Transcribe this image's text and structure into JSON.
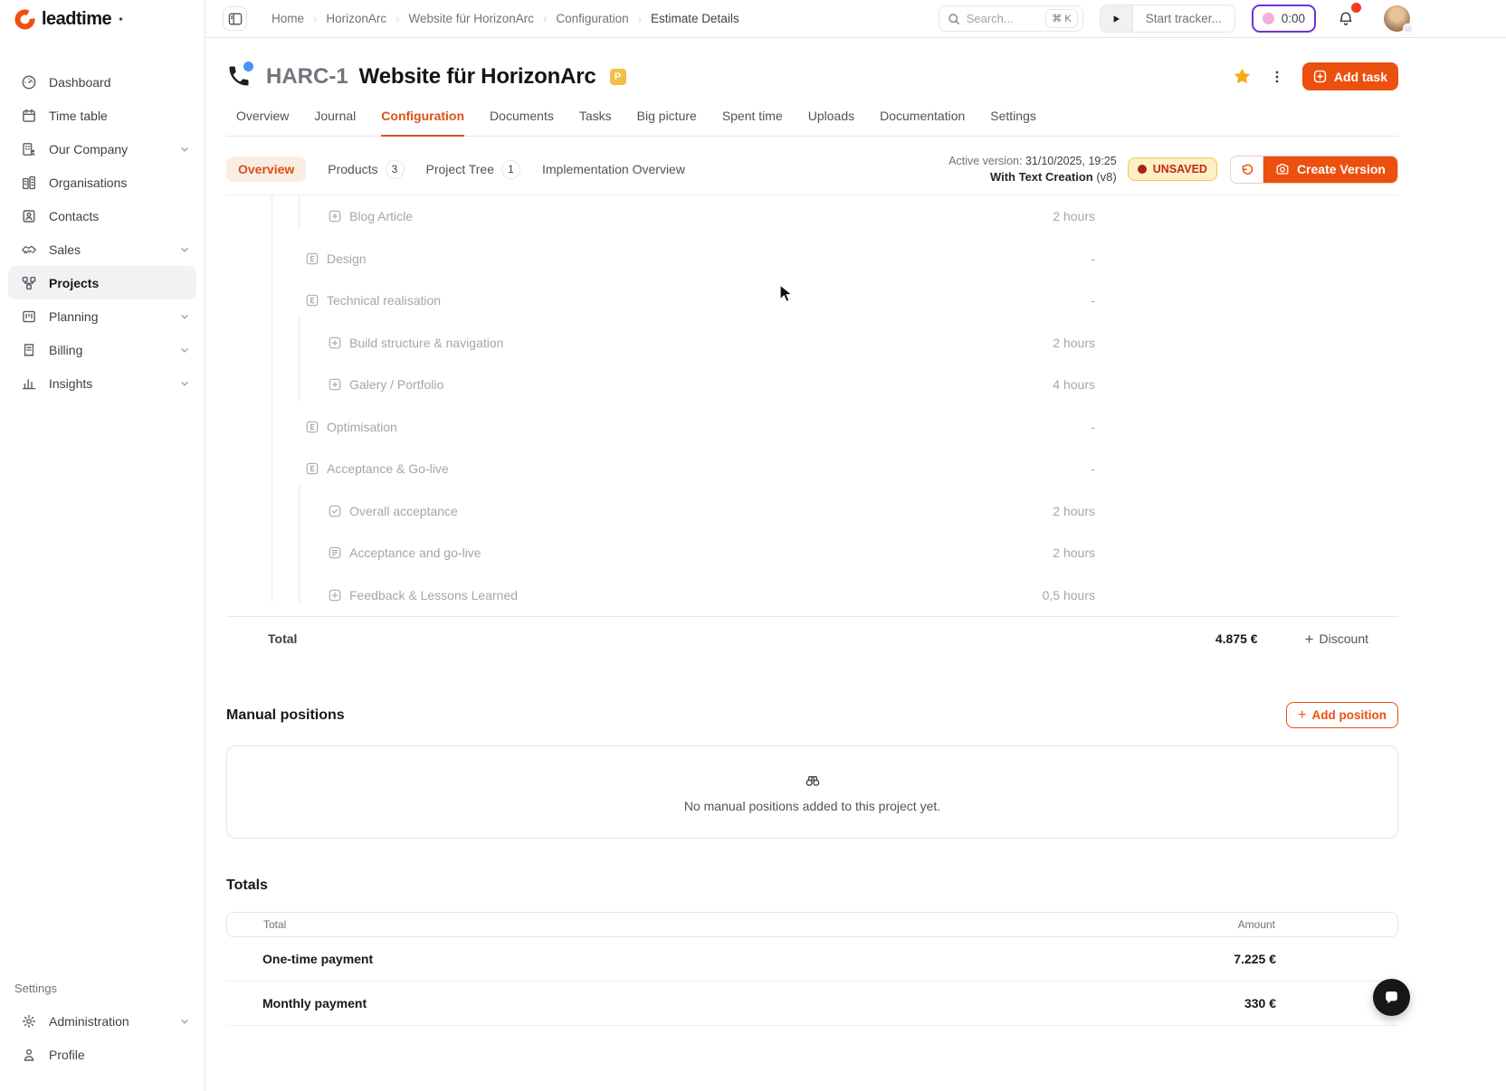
{
  "brand": {
    "name": "leadtime"
  },
  "sidebar": {
    "items": [
      {
        "label": "Dashboard"
      },
      {
        "label": "Time table"
      },
      {
        "label": "Our Company"
      },
      {
        "label": "Organisations"
      },
      {
        "label": "Contacts"
      },
      {
        "label": "Sales"
      },
      {
        "label": "Projects"
      },
      {
        "label": "Planning"
      },
      {
        "label": "Billing"
      },
      {
        "label": "Insights"
      }
    ],
    "settings_label": "Settings",
    "settings_items": [
      {
        "label": "Administration"
      },
      {
        "label": "Profile"
      }
    ]
  },
  "topbar": {
    "breadcrumb": [
      "Home",
      "HorizonArc",
      "Website für HorizonArc",
      "Configuration",
      "Estimate Details"
    ],
    "search": {
      "placeholder": "Search...",
      "shortcut": "⌘ K"
    },
    "tracker_label": "Start tracker...",
    "timer_value": "0:00"
  },
  "page": {
    "project_code": "HARC-1",
    "title": "Website für HorizonArc",
    "badge": "P",
    "add_task_label": "Add task"
  },
  "tabs": [
    "Overview",
    "Journal",
    "Configuration",
    "Documents",
    "Tasks",
    "Big picture",
    "Spent time",
    "Uploads",
    "Documentation",
    "Settings"
  ],
  "subtabs": {
    "overview": "Overview",
    "products": "Products",
    "products_count": "3",
    "project_tree": "Project Tree",
    "project_tree_count": "1",
    "implementation": "Implementation Overview"
  },
  "version": {
    "active_label": "Active version:",
    "date": "31/10/2025, 19:25",
    "name": "With Text Creation",
    "number": "(v8)",
    "unsaved_label": "UNSAVED",
    "create_label": "Create Version"
  },
  "tree": {
    "rows": [
      {
        "label": "Blog Article",
        "hours": "2 hours",
        "type": "plus",
        "level": 2
      },
      {
        "label": "Design",
        "hours": "-",
        "type": "epic",
        "level": 1
      },
      {
        "label": "Technical realisation",
        "hours": "-",
        "type": "epic",
        "level": 1
      },
      {
        "label": "Build structure & navigation",
        "hours": "2 hours",
        "type": "plus",
        "level": 2
      },
      {
        "label": "Galery / Portfolio",
        "hours": "4 hours",
        "type": "plus",
        "level": 2
      },
      {
        "label": "Optimisation",
        "hours": "-",
        "type": "epic",
        "level": 1
      },
      {
        "label": "Acceptance & Go-live",
        "hours": "-",
        "type": "epic",
        "level": 1
      },
      {
        "label": "Overall acceptance",
        "hours": "2 hours",
        "type": "check",
        "level": 2
      },
      {
        "label": "Acceptance and go-live",
        "hours": "2 hours",
        "type": "form",
        "level": 2
      },
      {
        "label": "Feedback & Lessons Learned",
        "hours": "0,5 hours",
        "type": "plus",
        "level": 2
      }
    ],
    "total_label": "Total",
    "total_value": "4.875 €",
    "discount_label": "Discount"
  },
  "manual_positions": {
    "title": "Manual positions",
    "add_label": "Add position",
    "empty_text": "No manual positions added to this project yet."
  },
  "totals": {
    "title": "Totals",
    "col_total": "Total",
    "col_amount": "Amount",
    "rows": [
      {
        "label": "One-time payment",
        "amount": "7.225 €"
      },
      {
        "label": "Monthly payment",
        "amount": "330 €"
      }
    ]
  },
  "colors": {
    "accent": "#EC500E",
    "unsaved_bg": "#FCF0C4",
    "timer_ring": "#6B32D9"
  }
}
